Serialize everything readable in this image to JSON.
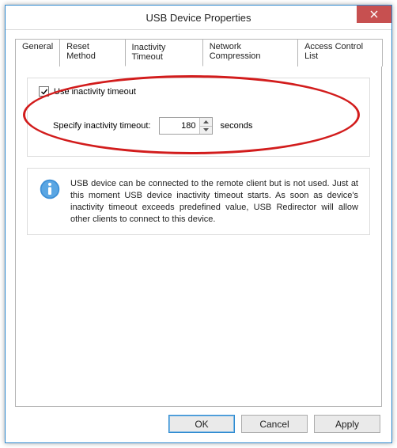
{
  "window": {
    "title": "USB Device Properties"
  },
  "tabs": [
    {
      "label": "General"
    },
    {
      "label": "Reset Method"
    },
    {
      "label": "Inactivity Timeout"
    },
    {
      "label": "Network Compression"
    },
    {
      "label": "Access Control List"
    }
  ],
  "active_tab_index": 2,
  "inactivity": {
    "use_checkbox_label": "Use inactivity timeout",
    "use_checked": true,
    "specify_label": "Specify inactivity timeout:",
    "value": "180",
    "unit_label": "seconds"
  },
  "info": {
    "text": "USB device can be connected to the remote client but is not used. Just at this moment USB device inactivity timeout starts. As soon as device's inactivity timeout exceeds predefined value, USB Redirector will allow other clients to connect to this device."
  },
  "buttons": {
    "ok": "OK",
    "cancel": "Cancel",
    "apply": "Apply"
  }
}
